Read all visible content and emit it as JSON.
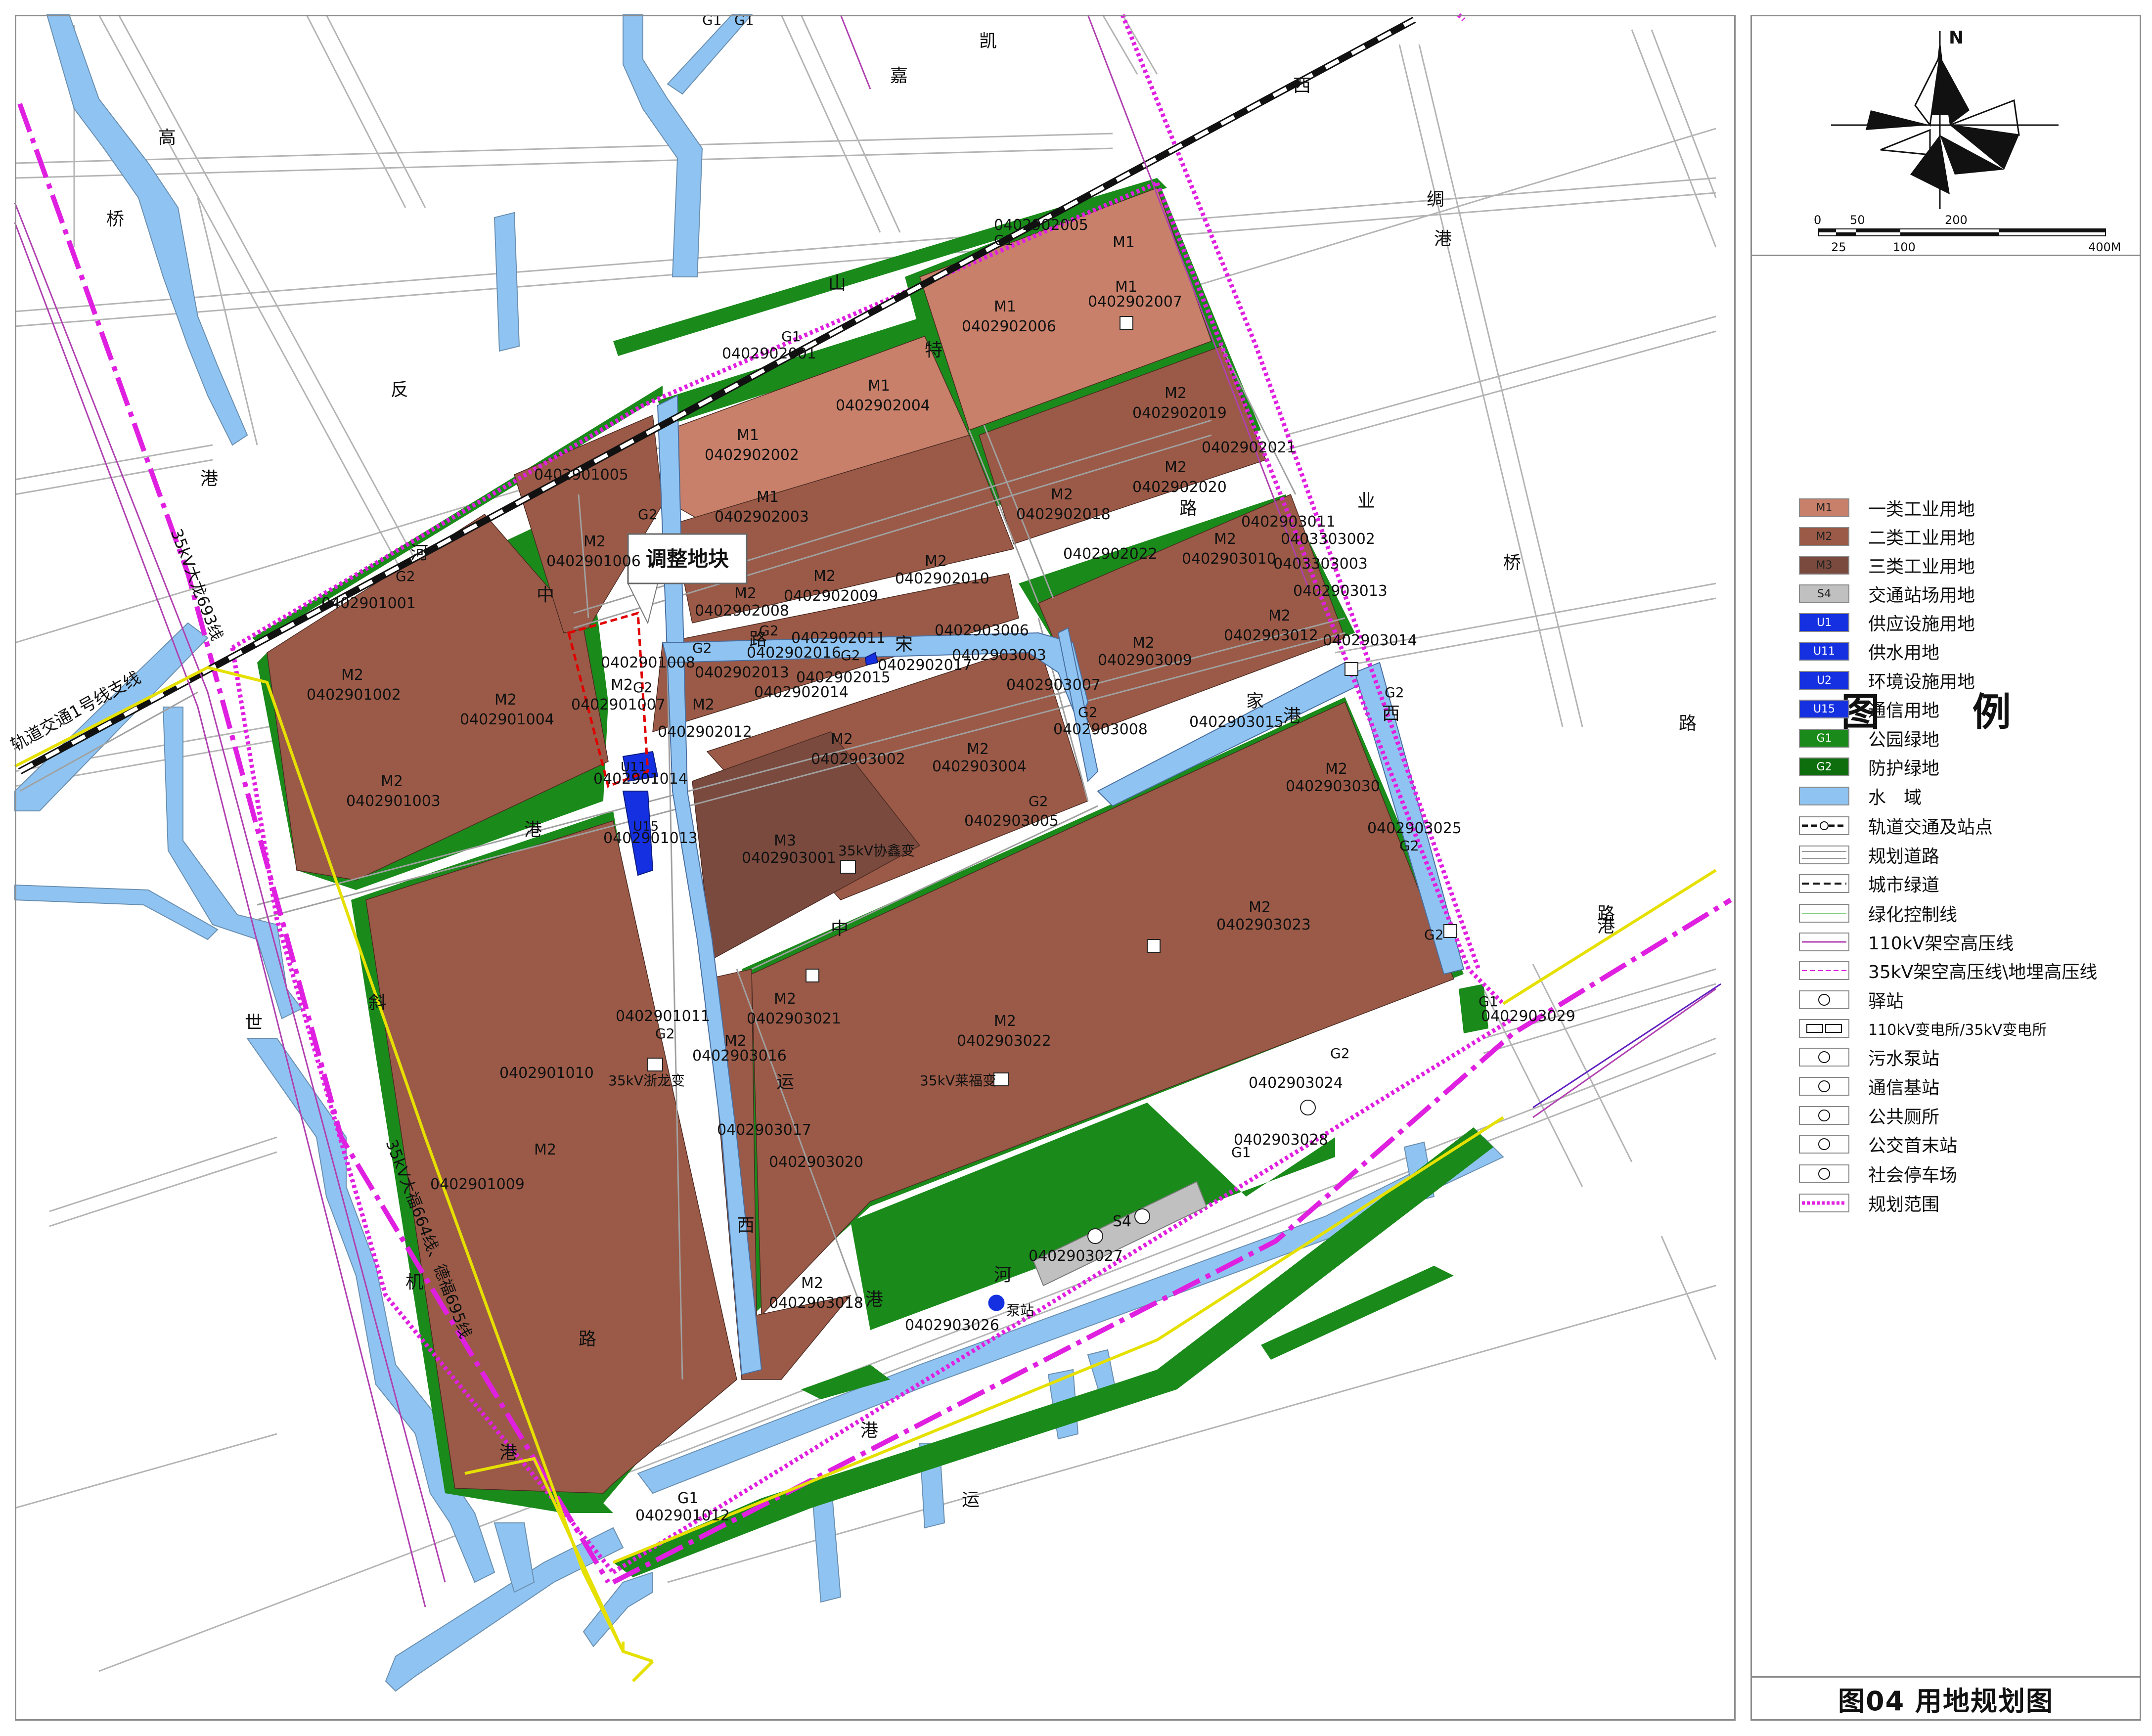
{
  "map_title": "图04 用地规划图",
  "compass": {
    "north_label": "N",
    "scale_top": [
      "0",
      "50",
      "200"
    ],
    "scale_bottom": [
      "25",
      "100",
      "400M"
    ]
  },
  "legend": {
    "title": "图 例",
    "items": [
      {
        "code": "M1",
        "label": "一类工业用地",
        "color": "#c8806a"
      },
      {
        "code": "M2",
        "label": "二类工业用地",
        "color": "#9b5a47"
      },
      {
        "code": "M3",
        "label": "三类工业用地",
        "color": "#7a4a3e"
      },
      {
        "code": "S4",
        "label": "交通站场用地",
        "color": "#c0c0c0"
      },
      {
        "code": "U1",
        "label": "供应设施用地",
        "color": "#1530e0"
      },
      {
        "code": "U11",
        "label": "供水用地",
        "color": "#1530e0"
      },
      {
        "code": "U2",
        "label": "环境设施用地",
        "color": "#1530e0"
      },
      {
        "code": "U15",
        "label": "通信用地",
        "color": "#1530e0"
      },
      {
        "code": "G1",
        "label": "公园绿地",
        "color": "#1a8a1a"
      },
      {
        "code": "G2",
        "label": "防护绿地",
        "color": "#0e6e0e"
      },
      {
        "code": "",
        "label": "水　域",
        "color": "#8fc4f2"
      },
      {
        "code": "",
        "label": "轨道交通及站点",
        "color": ""
      },
      {
        "code": "",
        "label": "规划道路",
        "color": ""
      },
      {
        "code": "",
        "label": "城市绿道",
        "color": ""
      },
      {
        "code": "",
        "label": "绿化控制线",
        "color": ""
      },
      {
        "code": "",
        "label": "110kV架空高压线",
        "color": ""
      },
      {
        "code": "",
        "label": "35kV架空高压线\\地埋高压线",
        "color": ""
      },
      {
        "code": "",
        "label": "驿站",
        "color": ""
      },
      {
        "code": "",
        "label": "110kV变电所/35kV变电所",
        "color": ""
      },
      {
        "code": "",
        "label": "污水泵站",
        "color": ""
      },
      {
        "code": "",
        "label": "通信基站",
        "color": ""
      },
      {
        "code": "",
        "label": "公共厕所",
        "color": ""
      },
      {
        "code": "",
        "label": "公交首末站",
        "color": ""
      },
      {
        "code": "",
        "label": "社会停车场",
        "color": ""
      },
      {
        "code": "",
        "label": "规划范围",
        "color": ""
      }
    ]
  },
  "colors": {
    "M1": "#c8806a",
    "M2": "#9b5a47",
    "M3": "#7a4a3e",
    "green": "#1a8a1a",
    "water": "#8fc4f2",
    "boundary": "#e020e0",
    "road_edge": "#9a9a9a",
    "rail": "#111111"
  },
  "callout": "调整地块",
  "road_labels": [
    "高",
    "桥",
    "反",
    "港",
    "嘉",
    "凯",
    "西",
    "山",
    "特",
    "路",
    "业",
    "港",
    "绸",
    "桥",
    "西",
    "路",
    "路",
    "河",
    "中",
    "路",
    "宋",
    "家",
    "港",
    "中",
    "港",
    "世",
    "河",
    "斜",
    "运",
    "港",
    "西",
    "路",
    "港",
    "运",
    "机",
    "港",
    "港",
    "河"
  ],
  "line_labels": [
    "G1",
    "G1",
    "轨道交通1号线支线",
    "35kV大龙693线",
    "35kV大福664线、德福695线"
  ],
  "facility_labels": [
    "35kV协鑫变",
    "35kV浙龙变",
    "35kV莱福变",
    "泵站",
    "S4"
  ],
  "parcel_codes": {
    "M1_a": "M1",
    "id_0402902005": "0402902005",
    "M1_b": "M1",
    "id_0402902006": "0402902006",
    "M1_c": "M1",
    "id_0402902007": "0402902007",
    "M1_d": "M1",
    "id_0402902004": "0402902004",
    "M1_e": "M1",
    "id_0402902002": "0402902002",
    "M1_f": "M1",
    "id_0402902003": "0402902003",
    "id_0402902001": "0402902001",
    "M2_19": "M2",
    "id_0402902019": "0402902019",
    "id_0402902021": "0402902021",
    "M2_20": "M2",
    "id_0402902020": "0402902020",
    "M2_18": "M2",
    "id_0402902018": "0402902018",
    "id_0402902022": "0402902022",
    "M2_10": "M2",
    "id_0402902010": "0402902010",
    "M2_09": "M2",
    "id_0402902009": "0402902009",
    "M2_08": "M2",
    "id_0402902008": "0402902008",
    "id_0402901005": "0402901005",
    "M2_06": "M2",
    "id_0402901006": "0402901006",
    "id_0402901001": "0402901001",
    "M2_02": "M2",
    "id_0402901002": "0402901002",
    "M2_04": "M2",
    "id_0402901004": "0402901004",
    "M2_03": "M2",
    "id_0402901003": "0402901003",
    "id_0402901008": "0402901008",
    "M2_07": "M2",
    "id_0402901007": "0402901007",
    "id_0402901014": "0402901014",
    "id_0402901013": "0402901013",
    "id_0402902011": "0402902011",
    "id_0402902016": "0402902016",
    "id_0402902017": "0402902017",
    "id_0402902013": "0402902013",
    "id_0402902015": "0402902015",
    "id_0402902014": "0402902014",
    "M2_12": "M2",
    "id_0402902012": "0402902012",
    "id_0402903006": "0402903006",
    "id_0402903003": "0402903003",
    "id_0402903007": "0402903007",
    "M2_3009": "M2",
    "id_0402903009": "0402903009",
    "id_0402903011": "0402903011",
    "id_0403303002": "0403303002",
    "M2_3010": "M2",
    "id_0402903010": "0402903010",
    "id_0403303003": "0403303003",
    "id_0402903013": "0402903013",
    "M2_3012": "M2",
    "id_0402903012": "0402903012",
    "id_0402903014": "0402903014",
    "id_0402903008": "0402903008",
    "id_0402903015": "0402903015",
    "M2_3002": "M2",
    "id_0402903002": "0402903002",
    "M2_3004": "M2",
    "id_0402903004": "0402903004",
    "M3_3001": "M3",
    "id_0402903001": "0402903001",
    "id_0402903005": "0402903005",
    "M2_3030": "M2",
    "id_0402903030": "0402903030",
    "id_0402903025": "0402903025",
    "M2_3023": "M2",
    "id_0402903023": "0402903023",
    "M2_3021": "M2",
    "id_0402903021": "0402903021",
    "M2_3022": "M2",
    "id_0402903022": "0402903022",
    "id_0402903029": "0402903029",
    "id_0402903024": "0402903024",
    "id_0402903028": "0402903028",
    "id_0402901011": "0402901011",
    "M2_1010": "M2",
    "id_0402901010": "0402901010",
    "M2_3016": "M2",
    "id_0402903016": "0402903016",
    "id_0402903017": "0402903017",
    "id_0402903020": "0402903020",
    "id_0402901009": "0402901009",
    "M2_3018": "M2",
    "id_0402903018": "0402903018",
    "id_0402903027": "0402903027",
    "id_0402903026": "0402903026",
    "G1_1012": "G1",
    "id_0402901012": "0402901012",
    "G2_a": "G2",
    "G2_b": "G2",
    "G2_c": "G2",
    "G2_d": "G2",
    "G2_e": "G2",
    "G2_f": "G2",
    "G2_g": "G2",
    "G2_h": "G2",
    "G2_i": "G2",
    "G2_j": "G2",
    "G2_k": "G2",
    "G2_l": "G2",
    "G2_m": "G2",
    "G1_a": "G1",
    "G1_b": "G1",
    "G1_c": "G1",
    "G1_d": "G1",
    "U11": "U11",
    "U15": "U15",
    "S4": "S4"
  }
}
